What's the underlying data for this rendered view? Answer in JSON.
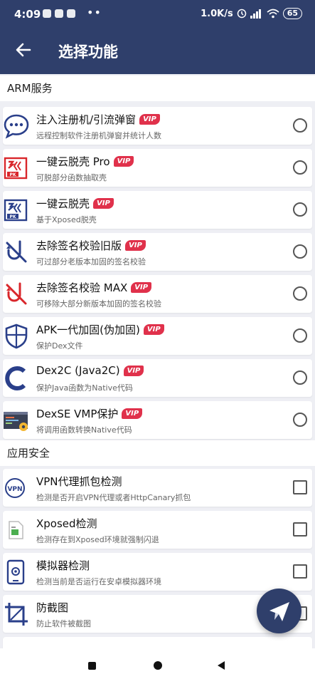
{
  "status_bar": {
    "time": "4:09",
    "network_speed": "1.0K/s",
    "battery": "65"
  },
  "header": {
    "title": "选择功能"
  },
  "sections": [
    {
      "title": "ARM服务"
    },
    {
      "title": "应用安全"
    }
  ],
  "vip_badge": "VIP",
  "arm_items": [
    {
      "name": "注入注册机/引流弹窗",
      "desc": "远程控制软件注册机弹窗并统计人数",
      "icon": "chat-bubble-icon"
    },
    {
      "name": "一键云脱壳 Pro",
      "desc": "可脱部分函数抽取壳",
      "icon": "unpack-pro-icon"
    },
    {
      "name": "一键云脱壳",
      "desc": "基于Xposed脱壳",
      "icon": "unpack-icon"
    },
    {
      "name": "去除签名校验旧版",
      "desc": "可过部分老版本加固的签名校验",
      "icon": "no-signature-icon"
    },
    {
      "name": "去除签名校验 MAX",
      "desc": "可移除大部分新版本加固的签名校验",
      "icon": "no-signature-max-icon"
    },
    {
      "name": "APK一代加固(伪加固)",
      "desc": "保护Dex文件",
      "icon": "shield-icon"
    },
    {
      "name": "Dex2C (Java2C)",
      "desc": "保护Java函数为Native代码",
      "icon": "c-letter-icon"
    },
    {
      "name": "DexSE VMP保护",
      "desc": "将调用函数转换Native代码",
      "icon": "code-gear-icon"
    }
  ],
  "security_items": [
    {
      "name": "VPN代理抓包检测",
      "desc": "检测是否开启VPN代理或者HttpCanary抓包",
      "icon": "vpn-icon"
    },
    {
      "name": "Xposed检测",
      "desc": "检测存在到Xposed环境就强制闪退",
      "icon": "xposed-file-icon"
    },
    {
      "name": "模拟器检测",
      "desc": "检测当前是否运行在安卓模拟器环境",
      "icon": "phone-at-icon"
    },
    {
      "name": "防截图",
      "desc": "防止软件被截图",
      "icon": "crop-icon"
    }
  ],
  "colors": {
    "primary": "#2f3f6b",
    "vip": "#e0314b",
    "icon_red": "#d9262b",
    "icon_blue": "#2a3f8a"
  }
}
